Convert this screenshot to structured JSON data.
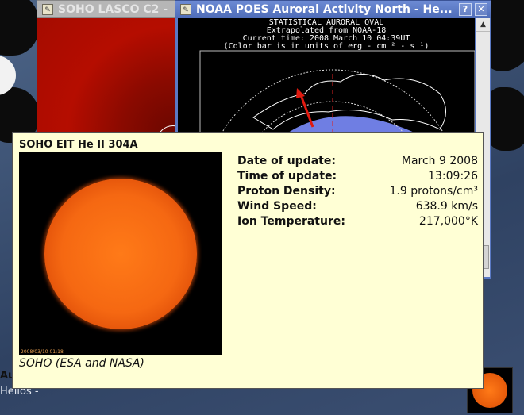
{
  "windows": {
    "lasco": {
      "title": "SOHO LASCO C2 -"
    },
    "noaa": {
      "title": "NOAA POES Auroral Activity North - He...",
      "help_label": "?",
      "close_label": "✕",
      "scroll_up": "▲",
      "image_text": {
        "line1": "STATISTICAL AURORAL OVAL",
        "line2": "Extrapolated from NOAA-18",
        "line3": "Current time: 2008 March 10 04:39UT",
        "line4": "(Color bar is in units of erg - cm⁻² - s⁻¹)"
      }
    }
  },
  "popup": {
    "title": "SOHO EIT He II 304A",
    "image_stamp": "2008/03/10 01:18",
    "credit": "SOHO (ESA and NASA)",
    "rows": [
      {
        "label": "Date of update:",
        "value": "March 9 2008"
      },
      {
        "label": "Time of update:",
        "value": "13:09:26"
      },
      {
        "label": "Proton Density:",
        "value": "1.9 protons/cm³"
      },
      {
        "label": "Wind Speed:",
        "value": "638.9 km/s"
      },
      {
        "label": "Ion Temperature:",
        "value": "217,000°K"
      }
    ]
  },
  "taskbar": {
    "item1": "Auror",
    "item2": "Helios -"
  },
  "colors": {
    "popup_bg": "#ffffd5",
    "noaa_title_bg": "#5a79c4",
    "lasco_red": "#b50d00",
    "aurora_blue": "#6f7ee3",
    "arrow_red": "#e01a10"
  },
  "icons": [
    "window-icon",
    "help-icon",
    "close-icon",
    "scroll-up-icon",
    "sun-thumbnail-icon"
  ]
}
